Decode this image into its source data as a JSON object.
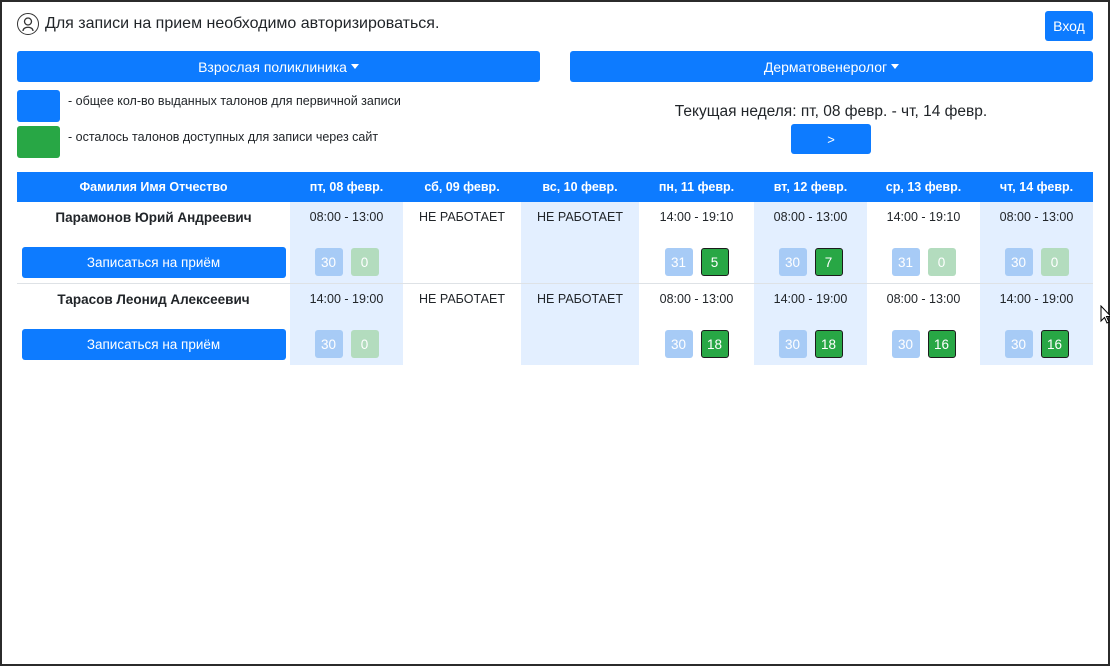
{
  "header": {
    "notice": "Для записи на прием необходимо авторизироваться.",
    "login_label": "Вход"
  },
  "filters": {
    "department": "Взрослая поликлиника",
    "specialty": "Дерматовенеролог"
  },
  "legend": {
    "blue_text": "- общее кол-во выданных талонов для первичной записи",
    "green_text": "- осталось талонов доступных для записи через сайт"
  },
  "colors": {
    "blue": "#0d7bff",
    "green": "#28a745",
    "shade": "#e3efff"
  },
  "week": {
    "label": "Текущая неделя: пт, 08 февр. - чт, 14 февр.",
    "next_label": ">"
  },
  "table": {
    "columns": [
      "Фамилия Имя Отчество",
      "пт, 08 февр.",
      "сб, 09 февр.",
      "вс, 10 февр.",
      "пн, 11 февр.",
      "вт, 12 февр.",
      "ср, 13 февр.",
      "чт, 14 февр."
    ],
    "book_label": "Записаться на приём",
    "closed_label": "НЕ РАБОТАЕТ",
    "doctors": [
      {
        "name": "Парамонов Юрий Андреевич",
        "days": [
          {
            "time": "08:00 - 13:00",
            "total": "30",
            "free": "0"
          },
          {
            "closed": true
          },
          {
            "closed": true
          },
          {
            "time": "14:00 - 19:10",
            "total": "31",
            "free": "5"
          },
          {
            "time": "08:00 - 13:00",
            "total": "30",
            "free": "7"
          },
          {
            "time": "14:00 - 19:10",
            "total": "31",
            "free": "0"
          },
          {
            "time": "08:00 - 13:00",
            "total": "30",
            "free": "0"
          }
        ]
      },
      {
        "name": "Тарасов Леонид Алексеевич",
        "days": [
          {
            "time": "14:00 - 19:00",
            "total": "30",
            "free": "0"
          },
          {
            "closed": true
          },
          {
            "closed": true
          },
          {
            "time": "08:00 - 13:00",
            "total": "30",
            "free": "18"
          },
          {
            "time": "14:00 - 19:00",
            "total": "30",
            "free": "18"
          },
          {
            "time": "08:00 - 13:00",
            "total": "30",
            "free": "16"
          },
          {
            "time": "14:00 - 19:00",
            "total": "30",
            "free": "16"
          }
        ]
      }
    ]
  }
}
